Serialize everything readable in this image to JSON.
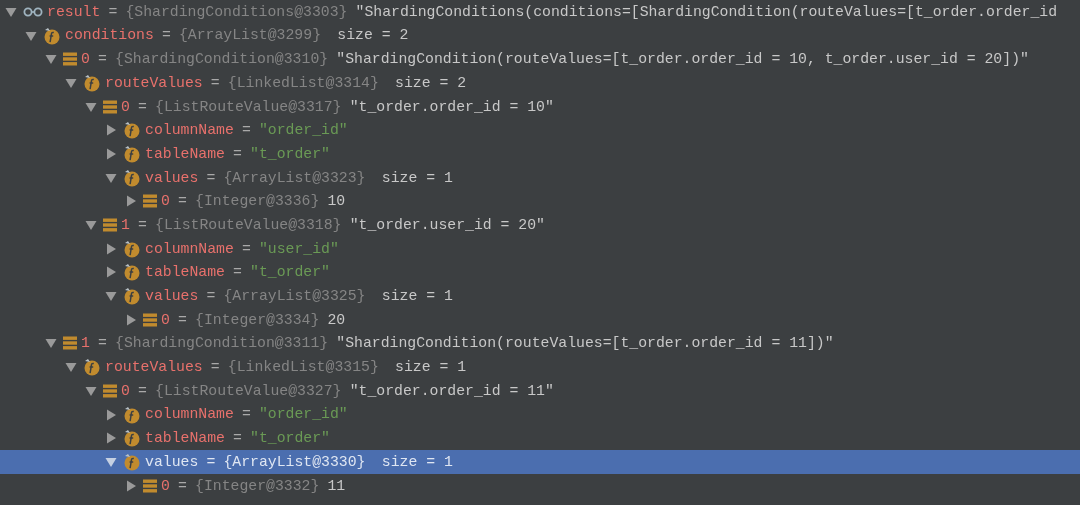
{
  "variables": [
    {
      "kind": "watch",
      "name": "result",
      "operator": "=",
      "type_ref": "{ShardingConditions@3303}",
      "value": "\"ShardingConditions(conditions=[ShardingCondition(routeValues=[t_order.order_id",
      "expanded": true,
      "selected": false,
      "children": [
        {
          "kind": "field",
          "name": "conditions",
          "operator": "=",
          "type_ref": "{ArrayList@3299}",
          "size": "size = 2",
          "expanded": true,
          "selected": false,
          "children": [
            {
              "kind": "element",
              "name": "0",
              "operator": "=",
              "type_ref": "{ShardingCondition@3310}",
              "value": "\"ShardingCondition(routeValues=[t_order.order_id = 10, t_order.user_id = 20])\"",
              "expanded": true,
              "selected": false,
              "children": [
                {
                  "kind": "field",
                  "name": "routeValues",
                  "operator": "=",
                  "type_ref": "{LinkedList@3314}",
                  "size": "size = 2",
                  "expanded": true,
                  "selected": false,
                  "children": [
                    {
                      "kind": "element",
                      "name": "0",
                      "operator": "=",
                      "type_ref": "{ListRouteValue@3317}",
                      "value": "\"t_order.order_id = 10\"",
                      "expanded": true,
                      "selected": false,
                      "children": [
                        {
                          "kind": "field",
                          "name": "columnName",
                          "operator": "=",
                          "string_value": "\"order_id\"",
                          "expanded": false,
                          "selected": false
                        },
                        {
                          "kind": "field",
                          "name": "tableName",
                          "operator": "=",
                          "string_value": "\"t_order\"",
                          "expanded": false,
                          "selected": false
                        },
                        {
                          "kind": "field",
                          "name": "values",
                          "operator": "=",
                          "type_ref": "{ArrayList@3323}",
                          "size": "size = 1",
                          "expanded": true,
                          "selected": false,
                          "children": [
                            {
                              "kind": "element",
                              "name": "0",
                              "operator": "=",
                              "type_ref": "{Integer@3336}",
                              "value": "10",
                              "expanded": false,
                              "selected": false
                            }
                          ]
                        }
                      ]
                    },
                    {
                      "kind": "element",
                      "name": "1",
                      "operator": "=",
                      "type_ref": "{ListRouteValue@3318}",
                      "value": "\"t_order.user_id = 20\"",
                      "expanded": true,
                      "selected": false,
                      "children": [
                        {
                          "kind": "field",
                          "name": "columnName",
                          "operator": "=",
                          "string_value": "\"user_id\"",
                          "expanded": false,
                          "selected": false
                        },
                        {
                          "kind": "field",
                          "name": "tableName",
                          "operator": "=",
                          "string_value": "\"t_order\"",
                          "expanded": false,
                          "selected": false
                        },
                        {
                          "kind": "field",
                          "name": "values",
                          "operator": "=",
                          "type_ref": "{ArrayList@3325}",
                          "size": "size = 1",
                          "expanded": true,
                          "selected": false,
                          "children": [
                            {
                              "kind": "element",
                              "name": "0",
                              "operator": "=",
                              "type_ref": "{Integer@3334}",
                              "value": "20",
                              "expanded": false,
                              "selected": false
                            }
                          ]
                        }
                      ]
                    }
                  ]
                }
              ]
            },
            {
              "kind": "element",
              "name": "1",
              "operator": "=",
              "type_ref": "{ShardingCondition@3311}",
              "value": "\"ShardingCondition(routeValues=[t_order.order_id = 11])\"",
              "expanded": true,
              "selected": false,
              "children": [
                {
                  "kind": "field",
                  "name": "routeValues",
                  "operator": "=",
                  "type_ref": "{LinkedList@3315}",
                  "size": "size = 1",
                  "expanded": true,
                  "selected": false,
                  "children": [
                    {
                      "kind": "element",
                      "name": "0",
                      "operator": "=",
                      "type_ref": "{ListRouteValue@3327}",
                      "value": "\"t_order.order_id = 11\"",
                      "expanded": true,
                      "selected": false,
                      "children": [
                        {
                          "kind": "field",
                          "name": "columnName",
                          "operator": "=",
                          "string_value": "\"order_id\"",
                          "expanded": false,
                          "selected": false
                        },
                        {
                          "kind": "field",
                          "name": "tableName",
                          "operator": "=",
                          "string_value": "\"t_order\"",
                          "expanded": false,
                          "selected": false
                        },
                        {
                          "kind": "field",
                          "name": "values",
                          "operator": "=",
                          "type_ref": "{ArrayList@3330}",
                          "size": "size = 1",
                          "expanded": true,
                          "selected": true,
                          "children": [
                            {
                              "kind": "element",
                              "name": "0",
                              "operator": "=",
                              "type_ref": "{Integer@3332}",
                              "value": "11",
                              "expanded": false,
                              "selected": false
                            }
                          ]
                        }
                      ]
                    }
                  ]
                }
              ]
            }
          ]
        }
      ]
    }
  ]
}
